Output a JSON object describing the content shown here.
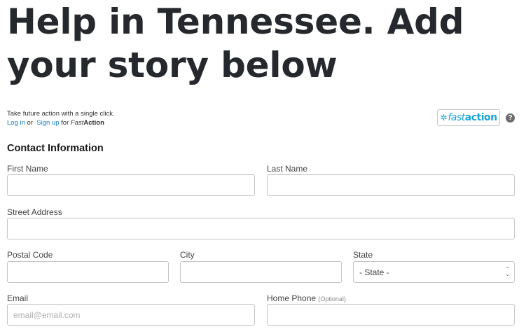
{
  "page": {
    "title": "Help in Tennessee. Add your story below"
  },
  "fastaction": {
    "prompt": "Take future action with a single click.",
    "login_label": "Log in",
    "or_label": "or",
    "signup_label": "Sign up",
    "for_label": "for",
    "brand_fast": "Fast",
    "brand_action": "Action",
    "logo_fast": "fast",
    "logo_action": "action",
    "help_glyph": "?"
  },
  "form": {
    "section_heading": "Contact Information",
    "first_name": {
      "label": "First Name",
      "value": "",
      "placeholder": ""
    },
    "last_name": {
      "label": "Last Name",
      "value": "",
      "placeholder": ""
    },
    "street_address": {
      "label": "Street Address",
      "value": "",
      "placeholder": ""
    },
    "postal_code": {
      "label": "Postal Code",
      "value": "",
      "placeholder": ""
    },
    "city": {
      "label": "City",
      "value": "",
      "placeholder": ""
    },
    "state": {
      "label": "State",
      "selected": "- State -"
    },
    "email": {
      "label": "Email",
      "value": "",
      "placeholder": "email@email.com"
    },
    "home_phone": {
      "label": "Home Phone",
      "optional": "(Optional)",
      "value": "",
      "placeholder": ""
    }
  },
  "colors": {
    "link": "#1a7fc8",
    "fastaction_brand": "#1aa3d9",
    "title": "#25282c"
  }
}
